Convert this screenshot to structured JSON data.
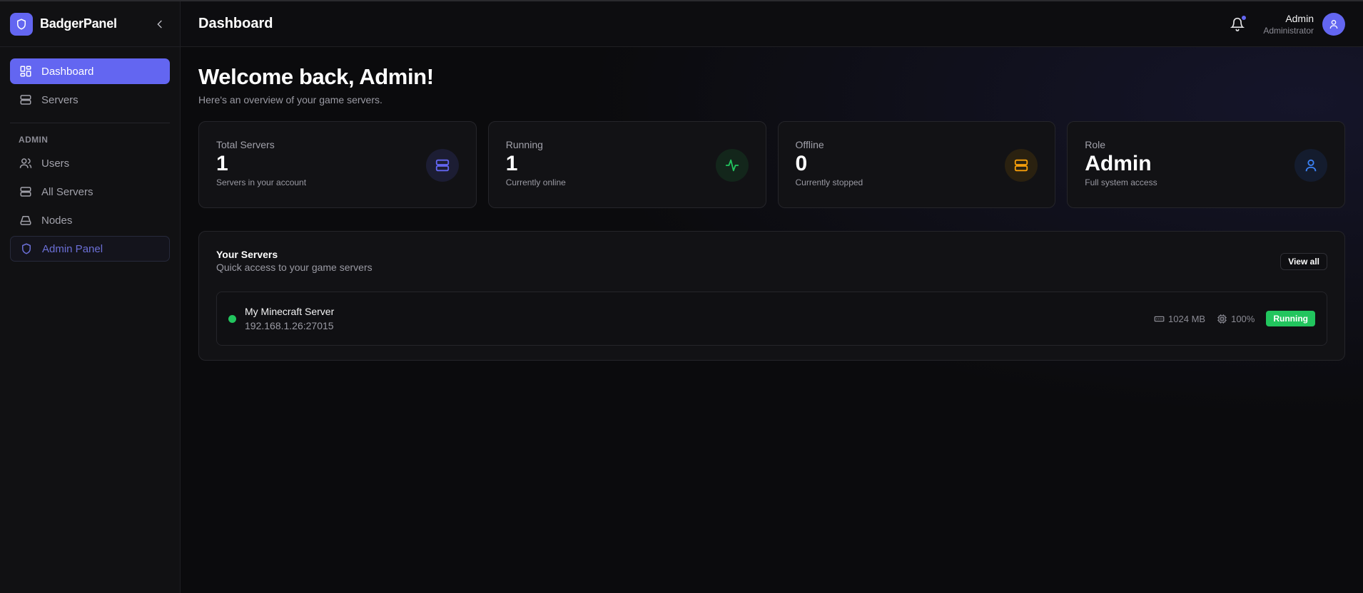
{
  "brand": {
    "name": "BadgerPanel"
  },
  "sidebar": {
    "items": [
      {
        "label": "Dashboard"
      },
      {
        "label": "Servers"
      }
    ],
    "section_label": "ADMIN",
    "admin_items": [
      {
        "label": "Users"
      },
      {
        "label": "All Servers"
      },
      {
        "label": "Nodes"
      },
      {
        "label": "Admin Panel"
      }
    ]
  },
  "header": {
    "title": "Dashboard",
    "user": {
      "name": "Admin",
      "role": "Administrator"
    }
  },
  "main": {
    "welcome": "Welcome back, Admin!",
    "welcome_sub": "Here's an overview of your game servers.",
    "stats": [
      {
        "label": "Total Servers",
        "value": "1",
        "sub": "Servers in your account",
        "icon": "server-icon",
        "color": "#6366f1"
      },
      {
        "label": "Running",
        "value": "1",
        "sub": "Currently online",
        "icon": "activity-icon",
        "color": "#22c55e"
      },
      {
        "label": "Offline",
        "value": "0",
        "sub": "Currently stopped",
        "icon": "server-icon",
        "color": "#f59e0b"
      },
      {
        "label": "Role",
        "value": "Admin",
        "sub": "Full system access",
        "icon": "user-icon",
        "color": "#3b82f6"
      }
    ],
    "servers": {
      "title": "Your Servers",
      "subtitle": "Quick access to your game servers",
      "view_all": "View all",
      "list": [
        {
          "name": "My Minecraft Server",
          "address": "192.168.1.26:27015",
          "memory": "1024 MB",
          "cpu": "100%",
          "status": "Running"
        }
      ]
    }
  }
}
